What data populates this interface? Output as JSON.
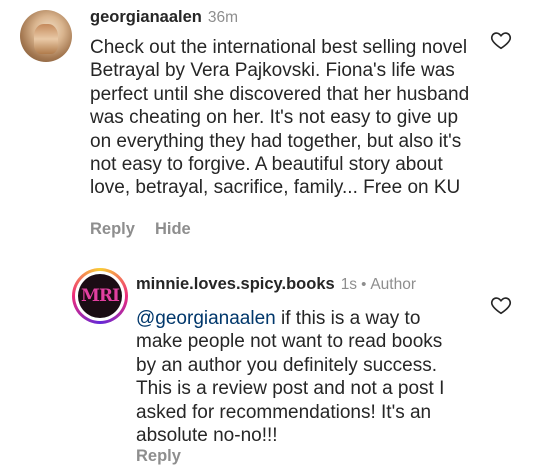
{
  "comments": [
    {
      "username": "georgianaalen",
      "time": "36m",
      "text": "Check out the international best selling novel Betrayal by Vera Pajkovski. Fiona's life was perfect until she discovered that her husband was cheating on her. It's not easy to give up on everything they had together, but also it's not easy to forgive. A beautiful story about love, betrayal, sacrifice, family... Free on KU",
      "actions": {
        "reply": "Reply",
        "hide": "Hide"
      },
      "icons": {
        "like": "heart-outline-icon"
      }
    },
    {
      "username": "minnie.loves.spicy.books",
      "time": "1s",
      "author_badge": "Author",
      "mention": "@georgianaalen",
      "text": " if this is a way to make people not want to read books by an author you definitely success. This is a review post and not a post I asked for recommendations! It's an absolute no-no!!!",
      "avatar_text": "MRI",
      "actions": {
        "reply": "Reply"
      },
      "icons": {
        "like": "heart-outline-icon"
      }
    }
  ],
  "colors": {
    "text": "#262626",
    "muted": "#8e8e8e",
    "mention": "#00376b"
  }
}
